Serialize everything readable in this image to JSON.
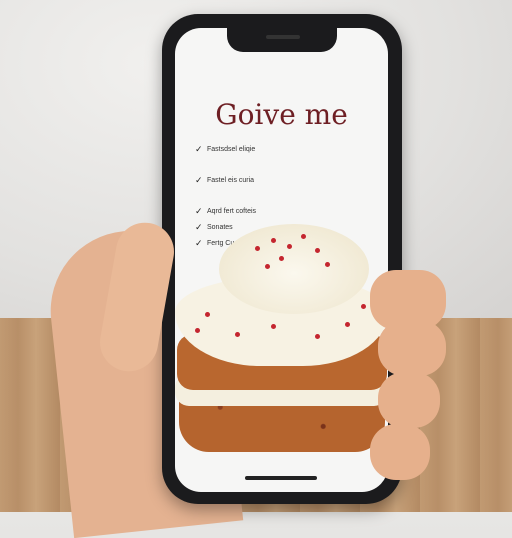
{
  "screen": {
    "title": "Goive me",
    "checklist": [
      {
        "label": "Fastsdsel eliqie"
      },
      {
        "label": "Fastel eis curia"
      },
      {
        "label": "Aqrd fert cofteis"
      },
      {
        "label": "Sonates"
      },
      {
        "label": "Fertg Cuesine"
      }
    ]
  },
  "colors": {
    "title": "#6e1f24",
    "phone_frame": "#1b1b1d",
    "sprinkle": "#c4262f"
  }
}
